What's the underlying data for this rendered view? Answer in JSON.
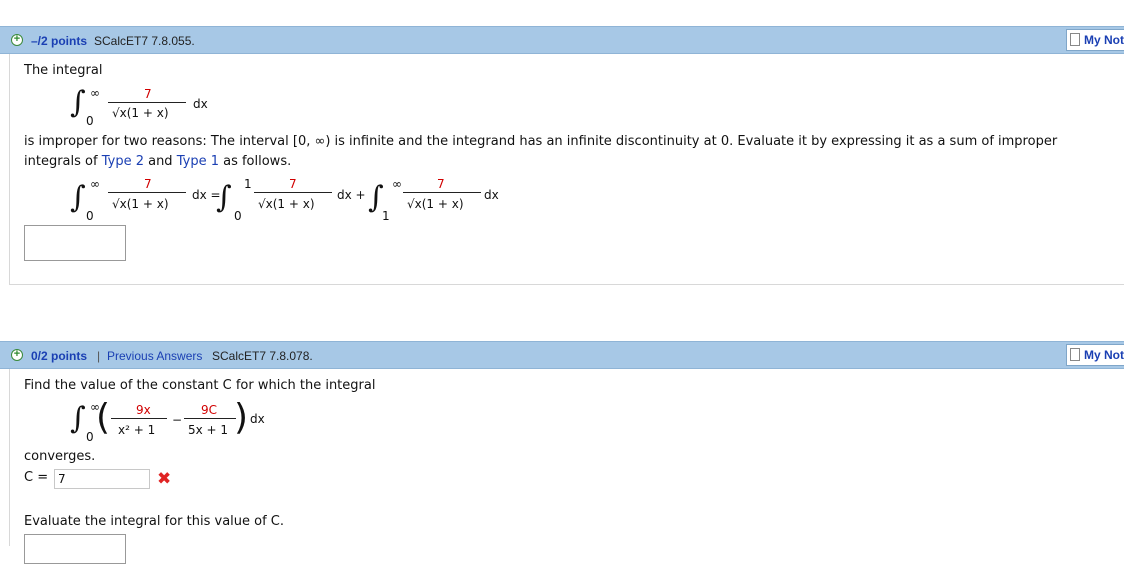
{
  "q1": {
    "points": "–/2 points",
    "code": "SCalcET7 7.8.055.",
    "my_notes": "My Not",
    "intro": "The integral",
    "int_upper": "∞",
    "int_lower": "0",
    "numer": "7",
    "denom": "√x(1 + x)",
    "dx": "dx",
    "text_line1": "is improper for two reasons: The interval [0, ∞) is infinite and the integrand has an infinite discontinuity at 0. Evaluate it by expressing it as a sum of improper",
    "text_line2_a": "integrals of ",
    "type2": "Type 2",
    "text_line2_b": " and ",
    "type1": "Type 1",
    "text_line2_c": " as follows.",
    "eq": "dx =",
    "plus": "dx +",
    "split_upper1": "1",
    "split_lower2": "1",
    "answer": ""
  },
  "q2": {
    "points": "0/2 points",
    "sep": "|",
    "prev": "Previous Answers",
    "code": "SCalcET7 7.8.078.",
    "my_notes": "My Not",
    "intro": "Find the value of the constant C for which the integral",
    "int_upper": "∞",
    "int_lower": "0",
    "n1": "9x",
    "d1": "x² + 1",
    "minus": "−",
    "n2": "9C",
    "d2": "5x + 1",
    "dx": "dx",
    "converges": "converges.",
    "c_label": "C =",
    "c_value": "7",
    "wrong_icon": "x-mark-icon",
    "evaluate": "Evaluate the integral for this value of C."
  }
}
